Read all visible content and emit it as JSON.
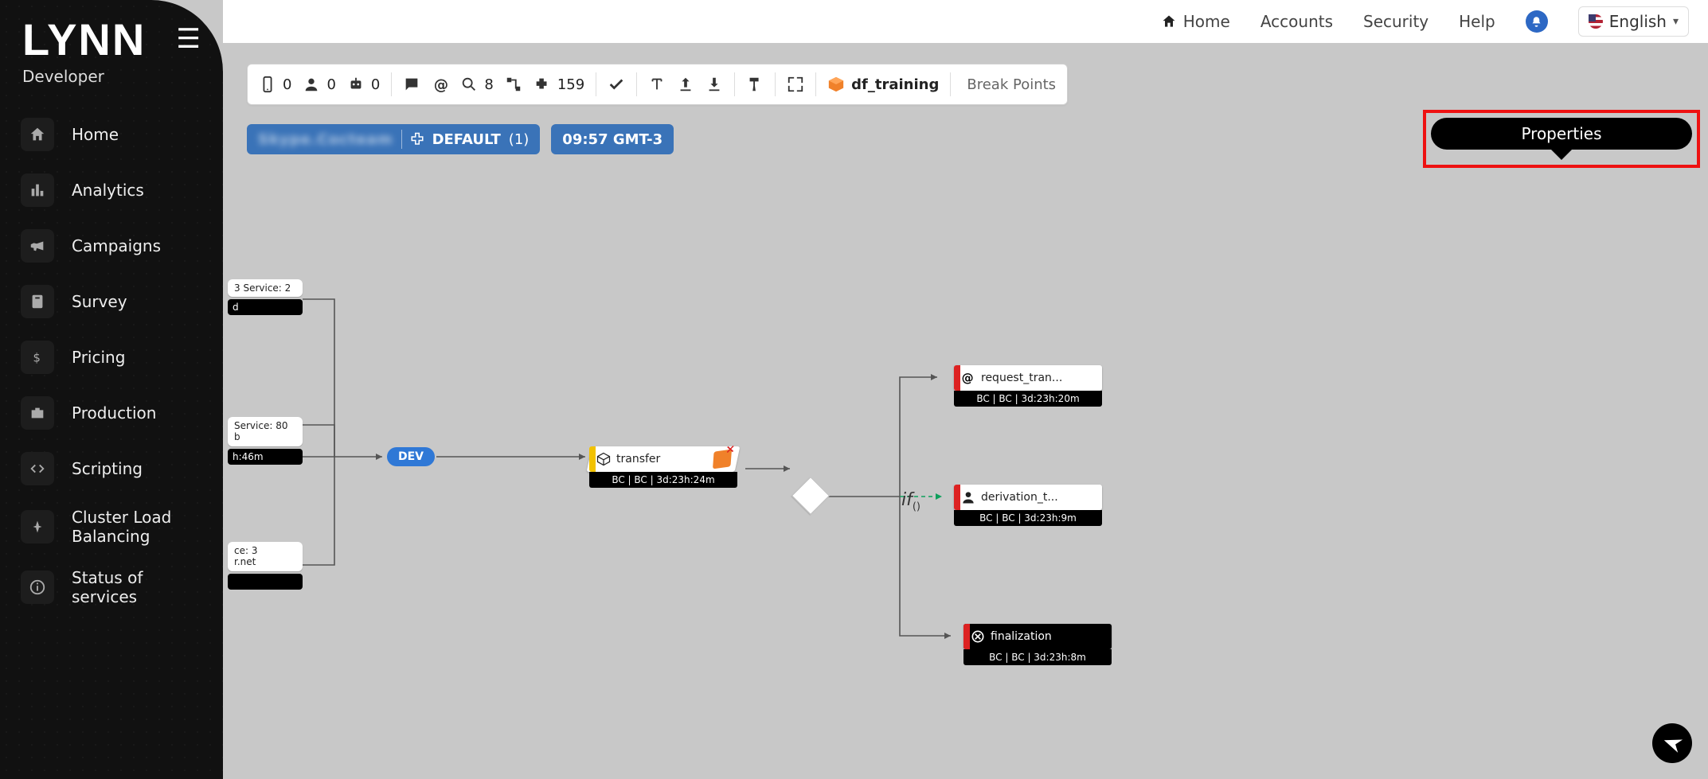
{
  "brand": {
    "name": "LYNN",
    "role": "Developer"
  },
  "sidebar": {
    "items": [
      {
        "label": "Home"
      },
      {
        "label": "Analytics"
      },
      {
        "label": "Campaigns"
      },
      {
        "label": "Survey"
      },
      {
        "label": "Pricing"
      },
      {
        "label": "Production"
      },
      {
        "label": "Scripting"
      },
      {
        "label": "Cluster Load Balancing"
      },
      {
        "label": "Status of services"
      }
    ]
  },
  "header": {
    "home": "Home",
    "accounts": "Accounts",
    "security": "Security",
    "help": "Help",
    "language": "English"
  },
  "toolbar": {
    "mobile": "0",
    "agent": "0",
    "bot": "0",
    "search": "8",
    "puzzle": "159",
    "project": "df_training",
    "breakpoints": "Break Points"
  },
  "pills": {
    "default_label": "DEFAULT",
    "default_count": "(1)",
    "time": "09:57 GMT-3"
  },
  "properties": {
    "label": "Properties"
  },
  "fragments": {
    "f1a": "3 Service: 2",
    "f1b": "d",
    "f2a": "Service: 80",
    "f2b": "b",
    "f2c": "h:46m",
    "f3a": "ce: 3",
    "f3b": "r.net"
  },
  "dev": {
    "label": "DEV"
  },
  "nodes": {
    "transfer": {
      "title": "transfer",
      "sub": "BC | BC | 3d:23h:24m"
    },
    "request": {
      "title": "request_tran...",
      "sub": "BC | BC | 3d:23h:20m"
    },
    "deriv": {
      "title": "derivation_t...",
      "sub": "BC | BC | 3d:23h:9m"
    },
    "final": {
      "title": "finalization",
      "sub": "BC | BC | 3d:23h:8m"
    },
    "iflabel": "if"
  }
}
